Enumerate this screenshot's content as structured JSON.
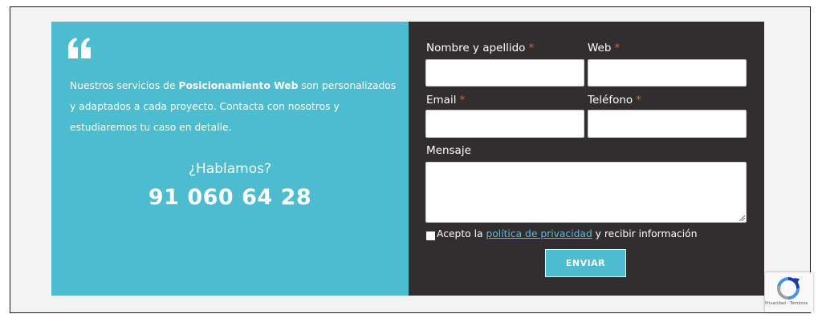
{
  "intro": {
    "text_before": "Nuestros servicios de ",
    "bold": "Posicionamiento Web",
    "text_after": " son personalizados y adaptados a cada proyecto. Contacta con nosotros y estudiaremos tu caso en detalle."
  },
  "cta": {
    "question": "¿Hablamos?",
    "phone": "91 060 64 28"
  },
  "form": {
    "name_label": "Nombre y apellido",
    "web_label": "Web",
    "email_label": "Email",
    "phone_label": "Teléfono",
    "message_label": "Mensaje",
    "required_mark": "*",
    "name_value": "",
    "web_value": "",
    "email_value": "",
    "phone_value": "",
    "message_value": "",
    "consent_before": "Acepto la ",
    "consent_link": "política de privacidad",
    "consent_after": " y recibir información",
    "submit_label": "ENVIAR"
  },
  "recaptcha": {
    "terms": "Privacidad - Términos"
  },
  "colors": {
    "accent": "#4dbccf",
    "dark_panel": "#312e2f",
    "required": "#e0603b",
    "link": "#5bb8e0"
  },
  "icons": [
    "quote-icon",
    "recaptcha-icon",
    "resize-grip-icon"
  ]
}
